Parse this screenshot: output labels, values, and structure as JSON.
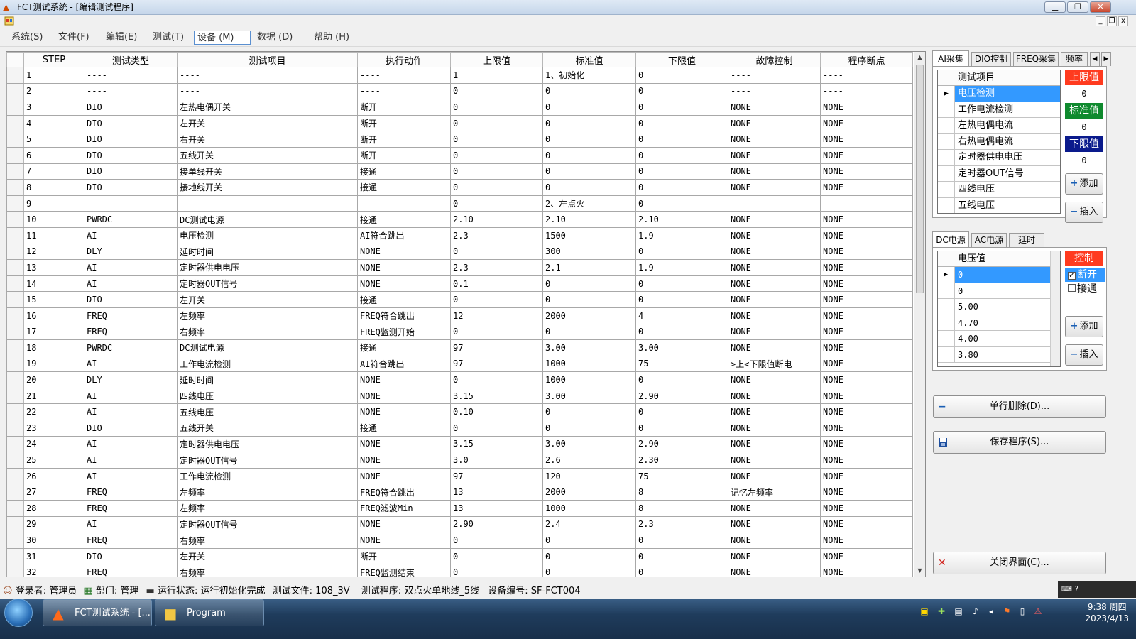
{
  "window": {
    "title": "FCT测试系统 - [编辑测试程序]",
    "min": "▁",
    "restore": "❐",
    "close": "✕"
  },
  "mdi": {
    "min": "_",
    "restore": "❐",
    "close": "x"
  },
  "menu": [
    {
      "label": "系统(S)"
    },
    {
      "label": "文件(F)"
    },
    {
      "label": "编辑(E)"
    },
    {
      "label": "测试(T)"
    },
    {
      "label": "设备 (M)"
    },
    {
      "label": "数据 (D)"
    },
    {
      "label": "帮助 (H)"
    }
  ],
  "grid": {
    "headers": [
      "STEP",
      "测试类型",
      "测试项目",
      "执行动作",
      "上限值",
      "标准值",
      "下限值",
      "故障控制",
      "程序断点"
    ],
    "rows": [
      [
        "1",
        "----",
        "----",
        "----",
        "1",
        "1、初始化",
        "0",
        "----",
        "----"
      ],
      [
        "2",
        "----",
        "----",
        "----",
        "0",
        "0",
        "0",
        "----",
        "----"
      ],
      [
        "3",
        "DIO",
        "左热电偶开关",
        "断开",
        "0",
        "0",
        "0",
        "NONE",
        "NONE"
      ],
      [
        "4",
        "DIO",
        "左开关",
        "断开",
        "0",
        "0",
        "0",
        "NONE",
        "NONE"
      ],
      [
        "5",
        "DIO",
        "右开关",
        "断开",
        "0",
        "0",
        "0",
        "NONE",
        "NONE"
      ],
      [
        "6",
        "DIO",
        "五线开关",
        "断开",
        "0",
        "0",
        "0",
        "NONE",
        "NONE"
      ],
      [
        "7",
        "DIO",
        "接单线开关",
        "接通",
        "0",
        "0",
        "0",
        "NONE",
        "NONE"
      ],
      [
        "8",
        "DIO",
        "接地线开关",
        "接通",
        "0",
        "0",
        "0",
        "NONE",
        "NONE"
      ],
      [
        "9",
        "----",
        "----",
        "----",
        "0",
        "2、左点火",
        "0",
        "----",
        "----"
      ],
      [
        "10",
        "PWRDC",
        "DC测试电源",
        "接通",
        "2.10",
        "2.10",
        "2.10",
        "NONE",
        "NONE"
      ],
      [
        "11",
        "AI",
        "电压检测",
        "AI符合跳出",
        "2.3",
        "1500",
        "1.9",
        "NONE",
        "NONE"
      ],
      [
        "12",
        "DLY",
        "延时时间",
        "NONE",
        "0",
        "300",
        "0",
        "NONE",
        "NONE"
      ],
      [
        "13",
        "AI",
        "定时器供电电压",
        "NONE",
        "2.3",
        "2.1",
        "1.9",
        "NONE",
        "NONE"
      ],
      [
        "14",
        "AI",
        "定时器OUT信号",
        "NONE",
        "0.1",
        "0",
        "0",
        "NONE",
        "NONE"
      ],
      [
        "15",
        "DIO",
        "左开关",
        "接通",
        "0",
        "0",
        "0",
        "NONE",
        "NONE"
      ],
      [
        "16",
        "FREQ",
        "左频率",
        "FREQ符合跳出",
        "12",
        "2000",
        "4",
        "NONE",
        "NONE"
      ],
      [
        "17",
        "FREQ",
        "右频率",
        "FREQ监测开始",
        "0",
        "0",
        "0",
        "NONE",
        "NONE"
      ],
      [
        "18",
        "PWRDC",
        "DC测试电源",
        "接通",
        "97",
        "3.00",
        "3.00",
        "NONE",
        "NONE"
      ],
      [
        "19",
        "AI",
        "工作电流检测",
        "AI符合跳出",
        "97",
        "1000",
        "75",
        ">上<下限值断电",
        "NONE"
      ],
      [
        "20",
        "DLY",
        "延时时间",
        "NONE",
        "0",
        "1000",
        "0",
        "NONE",
        "NONE"
      ],
      [
        "21",
        "AI",
        "四线电压",
        "NONE",
        "3.15",
        "3.00",
        "2.90",
        "NONE",
        "NONE"
      ],
      [
        "22",
        "AI",
        "五线电压",
        "NONE",
        "0.10",
        "0",
        "0",
        "NONE",
        "NONE"
      ],
      [
        "23",
        "DIO",
        "五线开关",
        "接通",
        "0",
        "0",
        "0",
        "NONE",
        "NONE"
      ],
      [
        "24",
        "AI",
        "定时器供电电压",
        "NONE",
        "3.15",
        "3.00",
        "2.90",
        "NONE",
        "NONE"
      ],
      [
        "25",
        "AI",
        "定时器OUT信号",
        "NONE",
        "3.0",
        "2.6",
        "2.30",
        "NONE",
        "NONE"
      ],
      [
        "26",
        "AI",
        "工作电流检测",
        "NONE",
        "97",
        "120",
        "75",
        "NONE",
        "NONE"
      ],
      [
        "27",
        "FREQ",
        "左频率",
        "FREQ符合跳出",
        "13",
        "2000",
        "8",
        "记忆左频率",
        "NONE"
      ],
      [
        "28",
        "FREQ",
        "左频率",
        "FREQ滤波Min",
        "13",
        "1000",
        "8",
        "NONE",
        "NONE"
      ],
      [
        "29",
        "AI",
        "定时器OUT信号",
        "NONE",
        "2.90",
        "2.4",
        "2.3",
        "NONE",
        "NONE"
      ],
      [
        "30",
        "FREQ",
        "右频率",
        "NONE",
        "0",
        "0",
        "0",
        "NONE",
        "NONE"
      ],
      [
        "31",
        "DIO",
        "左开关",
        "断开",
        "0",
        "0",
        "0",
        "NONE",
        "NONE"
      ],
      [
        "32",
        "FREQ",
        "右频率",
        "FREQ监测结束",
        "0",
        "0",
        "0",
        "NONE",
        "NONE"
      ]
    ]
  },
  "ai_panel": {
    "tabs": [
      "AI采集",
      "DIO控制",
      "FREQ采集",
      "频率"
    ],
    "list_header": "测试项目",
    "items": [
      "电压检测",
      "工作电流检测",
      "左热电偶电流",
      "右热电偶电流",
      "定时器供电电压",
      "定时器OUT信号",
      "四线电压",
      "五线电压"
    ],
    "upper_label": "上限值",
    "upper_value": "0",
    "std_label": "标准值",
    "std_value": "0",
    "lower_label": "下限值",
    "lower_value": "0",
    "add": "添加",
    "insert": "插入"
  },
  "dc_panel": {
    "tabs": [
      "DC电源",
      "AC电源",
      "延时"
    ],
    "list_header": "电压值",
    "items": [
      "0",
      "0",
      "5.00",
      "4.70",
      "4.00",
      "3.80"
    ],
    "control_label": "控制",
    "opt_off": "断开",
    "opt_on": "接通",
    "add": "添加",
    "insert": "插入"
  },
  "actions": {
    "delete": "单行删除(D)...",
    "save": "保存程序(S)...",
    "close": "关闭界面(C)..."
  },
  "status": {
    "user_label": "登录者:",
    "user": "管理员",
    "dept_label": "部门:",
    "dept": "管理",
    "state_label": "运行状态:",
    "state": "运行初始化完成",
    "file_label": "测试文件:",
    "file": "108_3V",
    "prog_label": "测试程序:",
    "prog": "双点火单地线_5线",
    "dev_label": "设备编号:",
    "dev": "SF-FCT004"
  },
  "taskbar": {
    "task1": "FCT测试系统 - [...",
    "task2": "Program",
    "time": "9:38 周四",
    "date": "2023/4/13"
  },
  "colors": {
    "upper": "#ff3b1f",
    "std": "#0f8a2e",
    "lower": "#0a1a8c",
    "selection": "#3399ff",
    "control": "#ff3b1f"
  }
}
